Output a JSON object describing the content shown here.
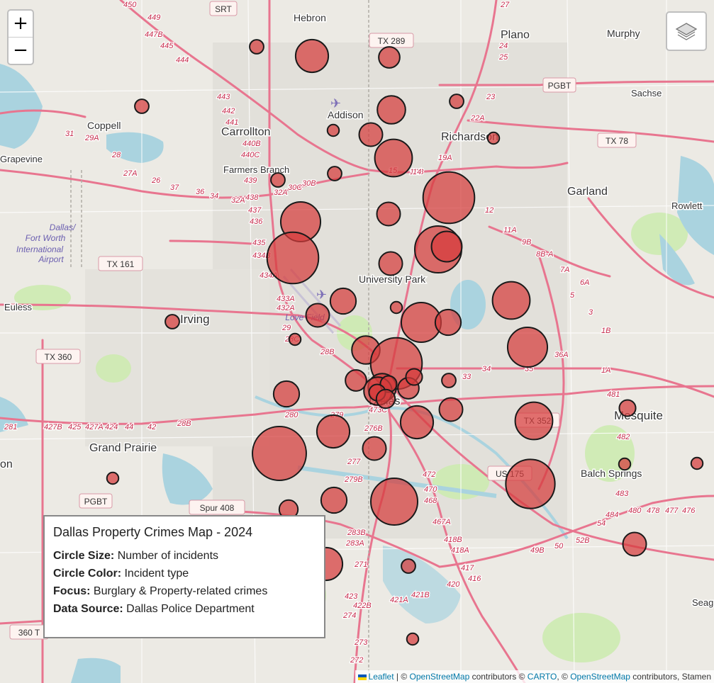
{
  "map": {
    "place_labels": [
      {
        "text": "Hebron",
        "size": 14
      },
      {
        "text": "Plano",
        "size": 16
      },
      {
        "text": "Murphy",
        "size": 14
      },
      {
        "text": "Sachse",
        "size": 13
      },
      {
        "text": "Addison",
        "size": 14
      },
      {
        "text": "Coppell",
        "size": 14
      },
      {
        "text": "Carrollton",
        "size": 16
      },
      {
        "text": "Richardson",
        "size": 16
      },
      {
        "text": "Grapevine",
        "size": 13
      },
      {
        "text": "Farmers Branch",
        "size": 13
      },
      {
        "text": "Garland",
        "size": 16
      },
      {
        "text": "Rowlett",
        "size": 13
      },
      {
        "text": "University Park",
        "size": 14
      },
      {
        "text": "Euless",
        "size": 13
      },
      {
        "text": "Irving",
        "size": 17
      },
      {
        "text": "Dallas",
        "size": 16
      },
      {
        "text": "Mesquite",
        "size": 17
      },
      {
        "text": "Grand Prairie",
        "size": 16
      },
      {
        "text": "Balch Springs",
        "size": 14
      },
      {
        "text": "Seag",
        "size": 13
      },
      {
        "text": "on",
        "size": 16
      }
    ],
    "airport_labels": [
      "Dallas/",
      "Fort Worth",
      "International",
      "Airport",
      "Love Field"
    ],
    "shields": [
      "SRT",
      "TX 289",
      "PGBT",
      "TX 78",
      "TX 161",
      "TX 360",
      "TX 352",
      "US 175",
      "PGBT",
      "Spur 408",
      "360 T"
    ],
    "exit_labels": [
      "450",
      "449",
      "447B",
      "445",
      "444",
      "443",
      "442",
      "441",
      "440B",
      "440C",
      "439",
      "438",
      "437",
      "436",
      "435",
      "434B",
      "434A",
      "433A",
      "432A",
      "29",
      "28C",
      "28B",
      "27",
      "25",
      "24",
      "23",
      "22A",
      "19A",
      "19B",
      "15",
      "14",
      "12",
      "11A",
      "9B",
      "8B-A",
      "7A",
      "6A",
      "5",
      "3",
      "1B",
      "1A",
      "481",
      "482",
      "483",
      "484",
      "480",
      "478",
      "477",
      "476",
      "54",
      "52B",
      "50",
      "49B",
      "36A",
      "35",
      "34",
      "33",
      "31",
      "29A",
      "28",
      "27A",
      "26",
      "37",
      "36",
      "34",
      "32A",
      "32A",
      "30C",
      "30B",
      "28B",
      "42",
      "44",
      "424",
      "425",
      "427A",
      "427B",
      "281",
      "280",
      "279",
      "279B",
      "277",
      "276B",
      "473C",
      "472",
      "470",
      "468",
      "467A",
      "418B",
      "418A",
      "417",
      "416",
      "420",
      "421B",
      "421A",
      "422B",
      "423",
      "274",
      "273",
      "272",
      "271",
      "283A",
      "283B"
    ],
    "crime_circles": [
      {
        "count": 6
      },
      {
        "count": 14
      },
      {
        "count": 9
      },
      {
        "count": 6
      },
      {
        "count": 12
      },
      {
        "count": 5
      },
      {
        "count": 6
      },
      {
        "count": 10
      },
      {
        "count": 16
      },
      {
        "count": 5
      },
      {
        "count": 6
      },
      {
        "count": 6
      },
      {
        "count": 22
      },
      {
        "count": 10
      },
      {
        "count": 17
      },
      {
        "count": 22
      },
      {
        "count": 10
      },
      {
        "count": 20
      },
      {
        "count": 13
      },
      {
        "count": 5
      },
      {
        "count": 11
      },
      {
        "count": 6
      },
      {
        "count": 17
      },
      {
        "count": 5
      },
      {
        "count": 10
      },
      {
        "count": 16
      },
      {
        "count": 11
      },
      {
        "count": 17
      },
      {
        "count": 6
      },
      {
        "count": 12
      },
      {
        "count": 22
      },
      {
        "count": 9
      },
      {
        "count": 12
      },
      {
        "count": 12
      },
      {
        "count": 9
      },
      {
        "count": 7
      },
      {
        "count": 7
      },
      {
        "count": 7
      },
      {
        "count": 8
      },
      {
        "count": 11
      },
      {
        "count": 14
      },
      {
        "count": 10
      },
      {
        "count": 16
      },
      {
        "count": 7
      },
      {
        "count": 5
      },
      {
        "count": 23
      },
      {
        "count": 14
      },
      {
        "count": 10
      },
      {
        "count": 21
      },
      {
        "count": 11
      },
      {
        "count": 8
      },
      {
        "count": 20
      },
      {
        "count": 14
      },
      {
        "count": 5
      },
      {
        "count": 10
      },
      {
        "count": 5
      },
      {
        "count": 5
      },
      {
        "count": 6
      }
    ]
  },
  "controls": {
    "zoom_in": "+",
    "zoom_out": "−"
  },
  "legend": {
    "title": "Dallas Property Crimes Map - 2024",
    "rows": [
      {
        "label": "Circle Size:",
        "value": "Number of incidents"
      },
      {
        "label": "Circle Color:",
        "value": "Incident type"
      },
      {
        "label": "Focus:",
        "value": "Burglary & Property-related crimes"
      },
      {
        "label": "Data Source:",
        "value": "Dallas Police Department"
      }
    ]
  },
  "attribution": {
    "leaflet": "Leaflet",
    "sep": " | © ",
    "osm1": "OpenStreetMap",
    "mid": " contributors © ",
    "carto": "CARTO",
    "mid2": ", © ",
    "osm2": "OpenStreetMap",
    "tail": " contributors, Stamen"
  },
  "colors": {
    "circle_fill": "#d63c3c",
    "road_pink": "#e8758f",
    "water": "#aad3df",
    "park": "#cdebb0"
  }
}
